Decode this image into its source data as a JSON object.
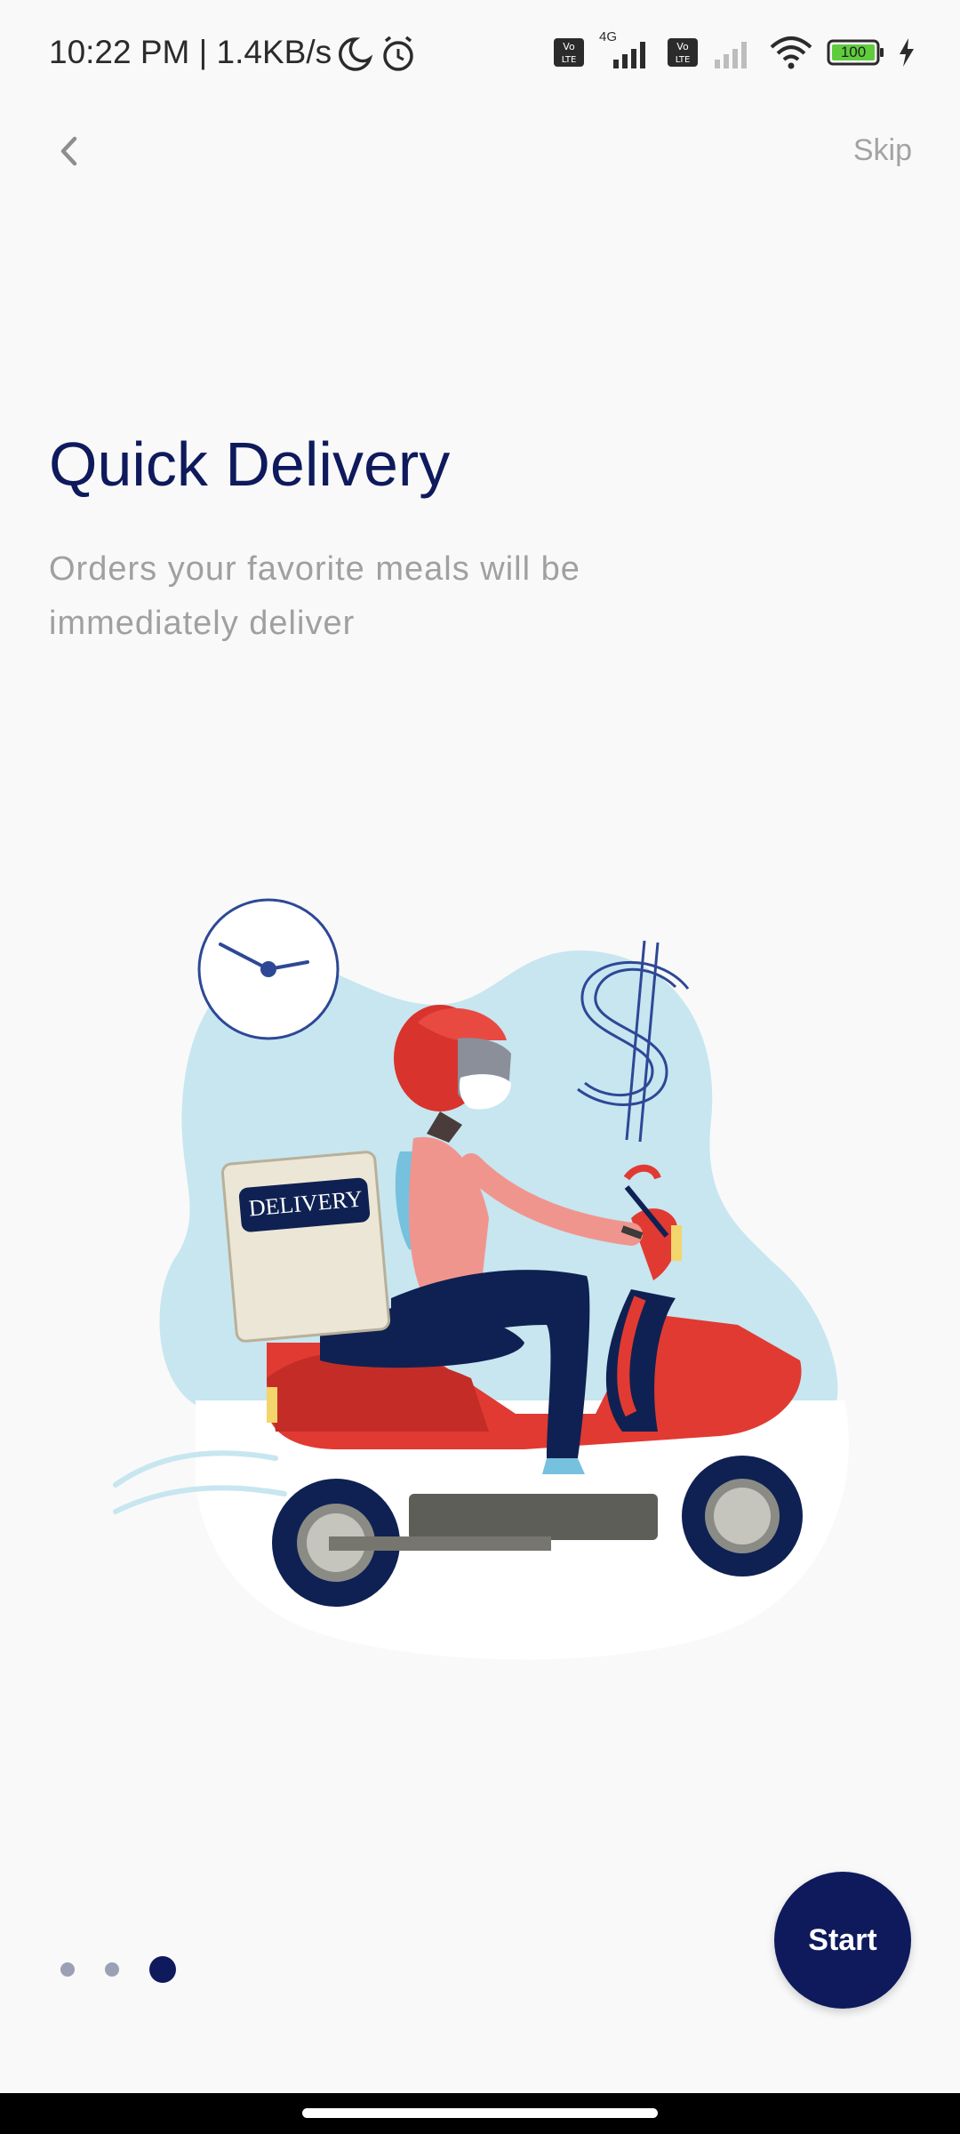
{
  "status_bar": {
    "time": "10:22 PM | 1.4KB/s",
    "network_label": "4G",
    "battery": "100",
    "icons": [
      "moon-icon",
      "alarm-icon",
      "volte-icon",
      "signal-icon",
      "volte-icon",
      "signal-icon",
      "wifi-icon",
      "battery-icon",
      "charging-icon"
    ]
  },
  "header": {
    "back_icon": "chevron-left-icon",
    "skip_label": "Skip"
  },
  "onboarding": {
    "title": "Quick Delivery",
    "subtitle": "Orders your favorite meals will be immediately deliver",
    "illustration": {
      "box_label": "DELIVERY",
      "elements": [
        "clock-icon",
        "dollar-icon",
        "scooter-illustration"
      ]
    },
    "pagination": {
      "total": 3,
      "active_index": 2
    },
    "start_label": "Start"
  },
  "colors": {
    "primary": "#0e1a5c",
    "muted_text": "#a0a0a0",
    "background": "#f9f9f9",
    "blob": "#c7e6f0",
    "scooter_red": "#e13a32"
  }
}
